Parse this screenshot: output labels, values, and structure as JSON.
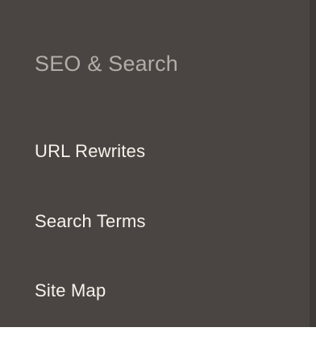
{
  "menu": {
    "section_title": "SEO & Search",
    "items": [
      {
        "label": "URL Rewrites"
      },
      {
        "label": "Search Terms"
      },
      {
        "label": "Site Map"
      }
    ]
  },
  "colors": {
    "panel_background": "#4a4542",
    "section_title": "#b3aca7",
    "menu_text": "#f7f3eb"
  }
}
